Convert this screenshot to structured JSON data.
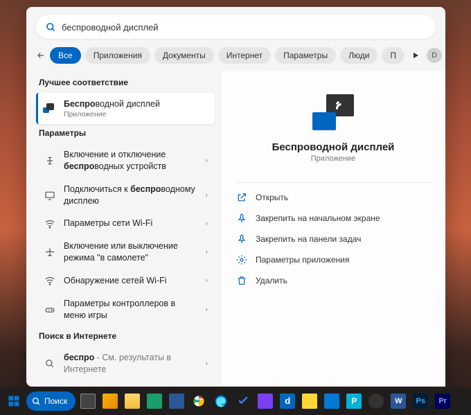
{
  "search": {
    "query": "беспроводной дисплей"
  },
  "filters": {
    "items": [
      "Все",
      "Приложения",
      "Документы",
      "Интернет",
      "Параметры",
      "Люди",
      "П"
    ],
    "active_index": 0,
    "avatar_letter": "D"
  },
  "sections": {
    "best_match": "Лучшее соответствие",
    "settings": "Параметры",
    "web": "Поиск в Интернете"
  },
  "best_match_result": {
    "title_pre": "Беспро",
    "title_rest": "водной дисплей",
    "subtitle": "Приложение"
  },
  "settings_results": [
    {
      "pre": "Включение и отключение ",
      "bold": "беспро",
      "post": "водных устройств",
      "icon": "toggle"
    },
    {
      "pre": "Подключиться к ",
      "bold": "беспро",
      "post": "водному дисплею",
      "icon": "display"
    },
    {
      "pre": "Параметры сети Wi-Fi",
      "bold": "",
      "post": "",
      "icon": "wifi"
    },
    {
      "pre": "Включение или выключение режима \"в самолете\"",
      "bold": "",
      "post": "",
      "icon": "airplane"
    },
    {
      "pre": "Обнаружение сетей Wi-Fi",
      "bold": "",
      "post": "",
      "icon": "wifi"
    },
    {
      "pre": "Параметры контроллеров в меню игры",
      "bold": "",
      "post": "",
      "icon": "controller"
    }
  ],
  "web_result": {
    "bold": "беспро",
    "suffix": " - См. результаты в Интернете"
  },
  "detail": {
    "title": "Беспроводной дисплей",
    "subtitle": "Приложение",
    "actions": [
      {
        "label": "Открыть",
        "icon": "open"
      },
      {
        "label": "Закрепить на начальном экране",
        "icon": "pin"
      },
      {
        "label": "Закрепить на панели задач",
        "icon": "pin"
      },
      {
        "label": "Параметры приложения",
        "icon": "gear"
      },
      {
        "label": "Удалить",
        "icon": "trash"
      }
    ]
  },
  "taskbar": {
    "search_label": "Поиск"
  }
}
